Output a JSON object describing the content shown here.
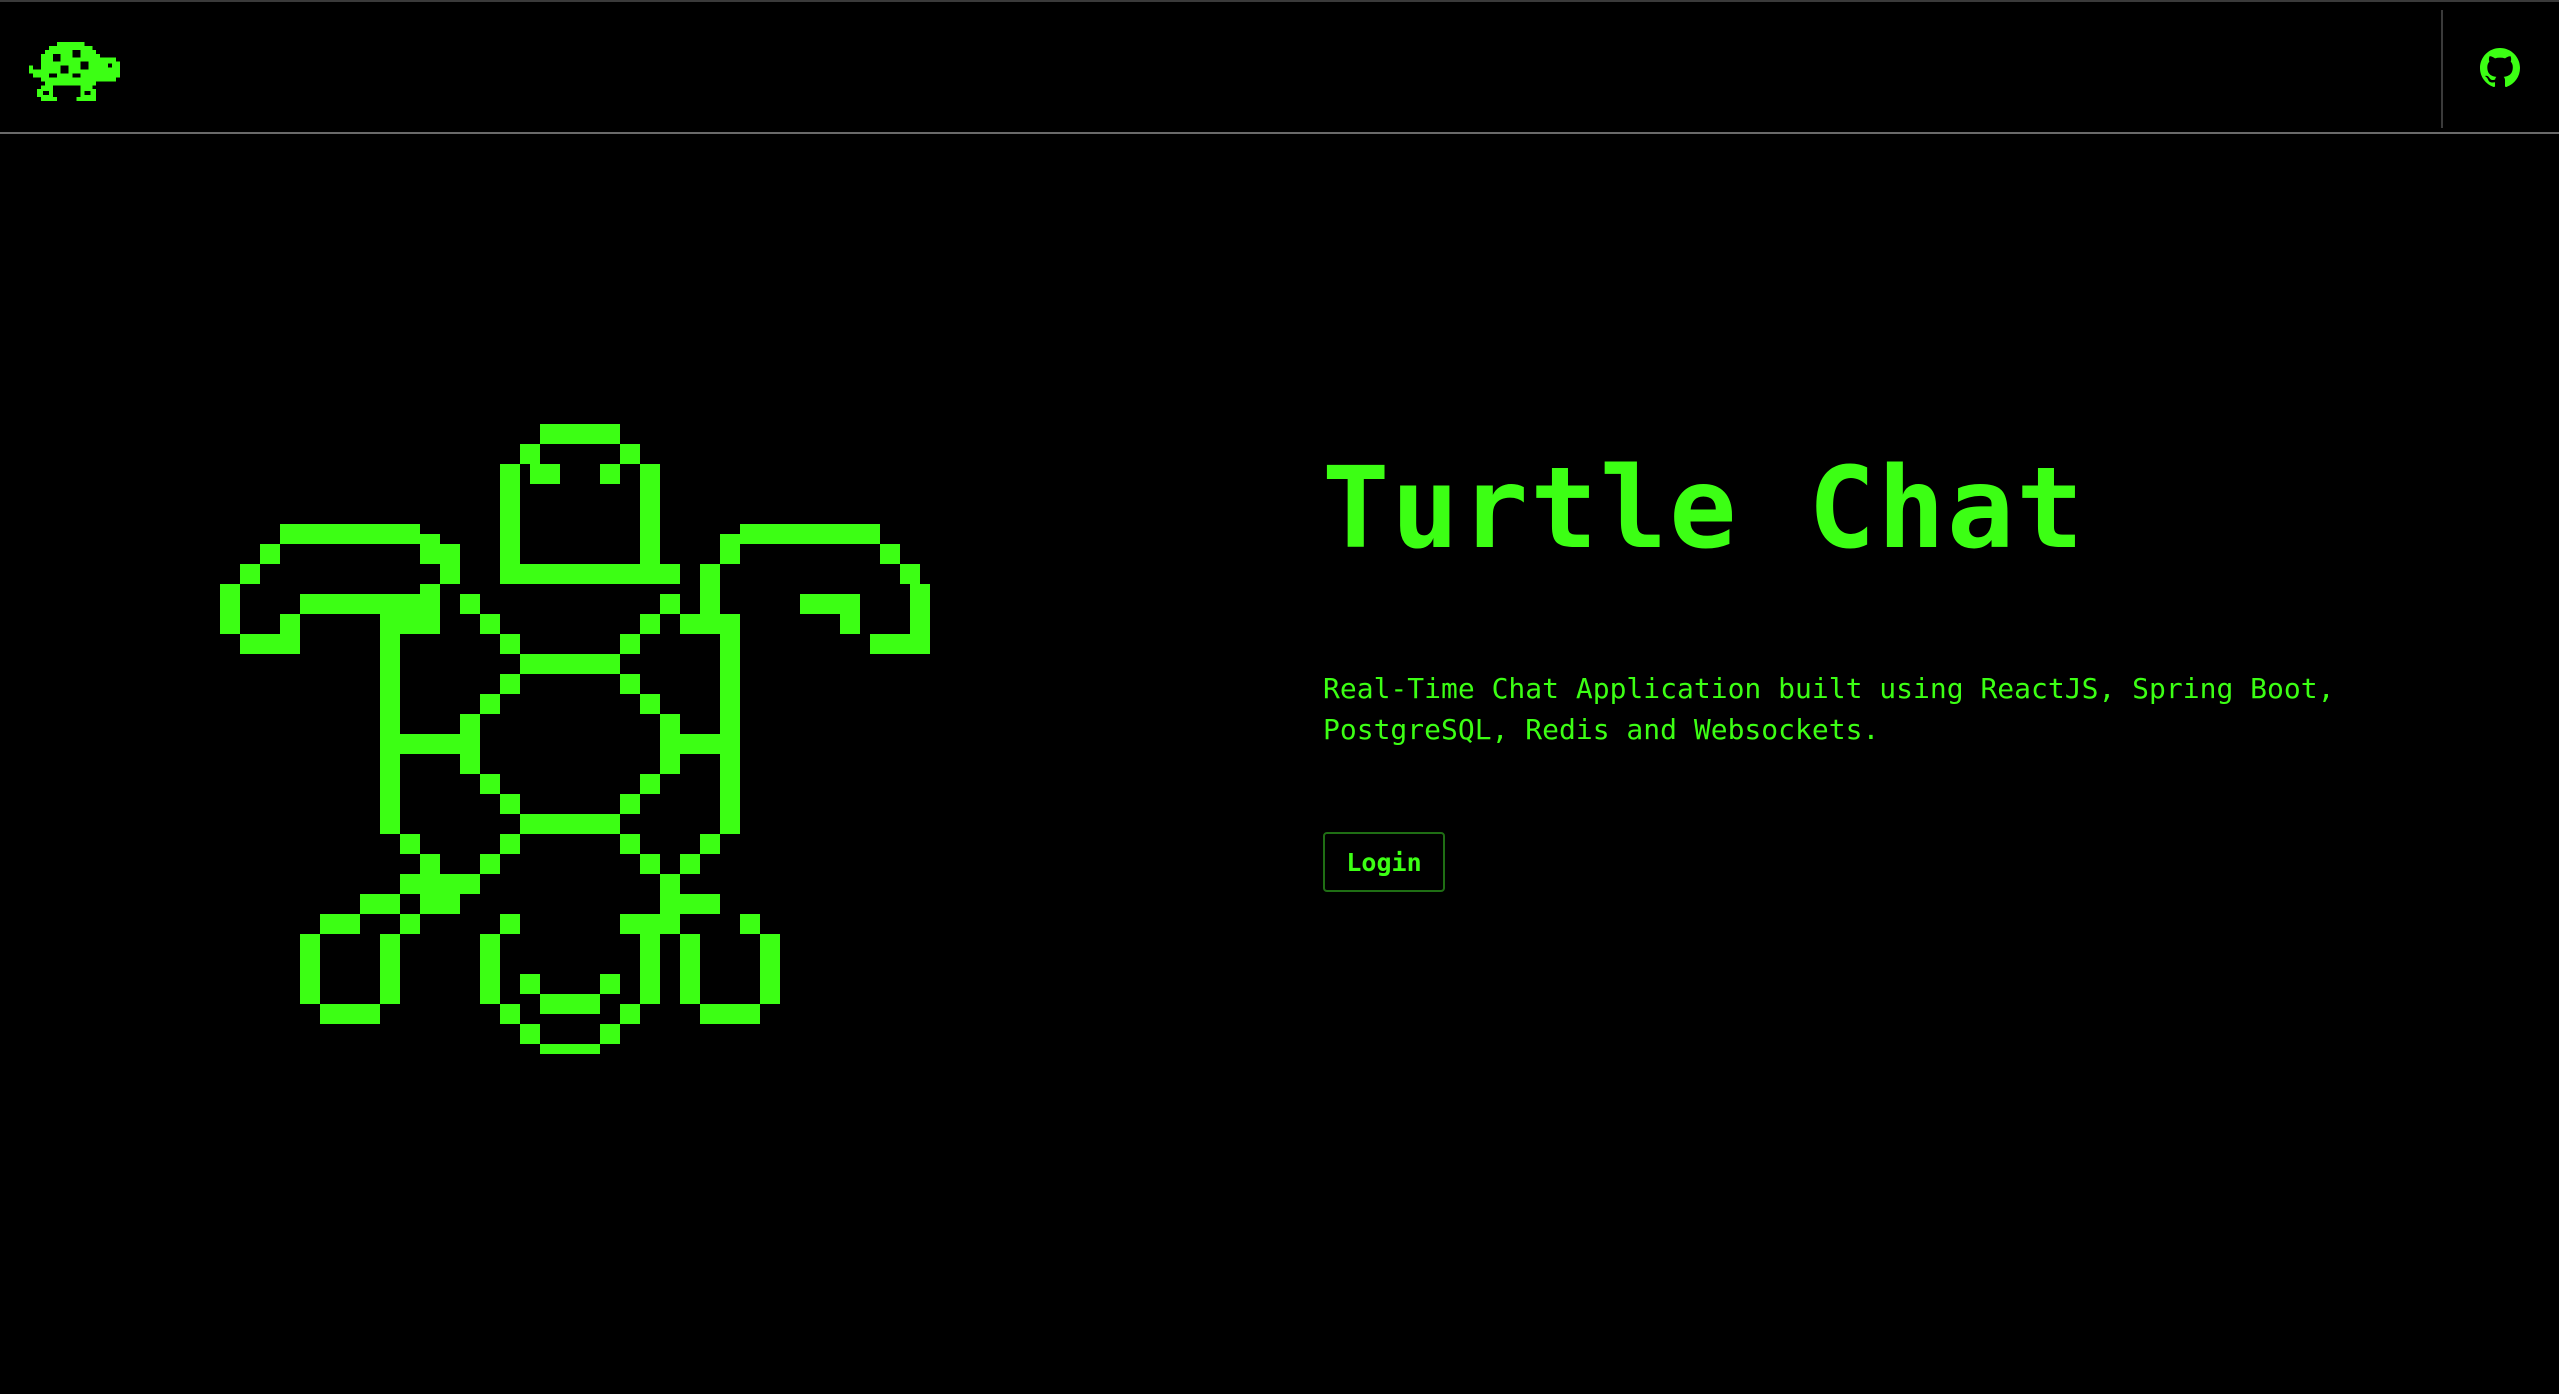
{
  "header": {
    "logo_icon": "turtle-logo-icon",
    "github_icon": "github-icon"
  },
  "hero": {
    "illustration_icon": "pixel-turtle-illustration",
    "title": "Turtle Chat",
    "description": "Real-Time Chat Application built using ReactJS, Spring Boot, PostgreSQL, Redis and Websockets.",
    "login_label": "Login"
  },
  "colors": {
    "background": "#000000",
    "accent": "#3cff14",
    "button_border": "#1f6e14",
    "divider": "#6a6a6a"
  }
}
